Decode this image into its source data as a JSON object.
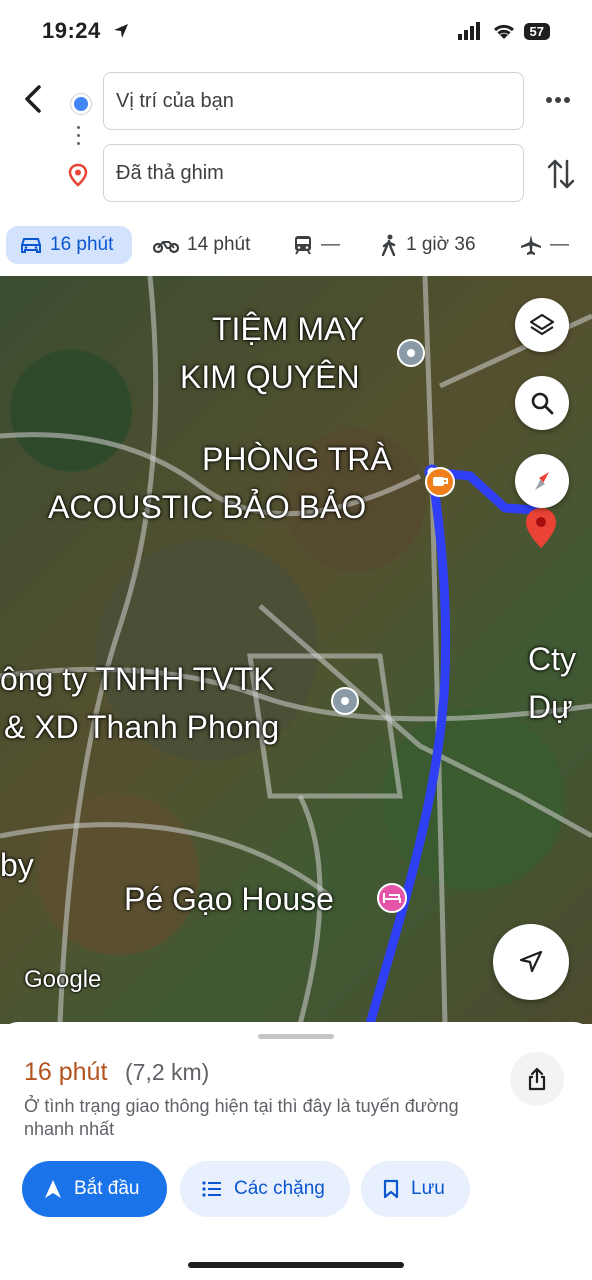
{
  "status_bar": {
    "time": "19:24",
    "battery": "57"
  },
  "directions": {
    "origin": "Vị trí của bạn",
    "destination": "Đã thả ghim"
  },
  "travel_modes": [
    {
      "mode": "car",
      "label": "16 phút",
      "selected": true
    },
    {
      "mode": "motorbike",
      "label": "14 phút"
    },
    {
      "mode": "transit",
      "label": "—"
    },
    {
      "mode": "walk",
      "label": "1 giờ 36"
    },
    {
      "mode": "flight",
      "label": "—"
    }
  ],
  "map": {
    "labels": {
      "tiem_may_1": "TIỆM MAY",
      "tiem_may_2": "KIM QUYÊN",
      "phong_tra_1": "PHÒNG TRÀ",
      "phong_tra_2": "ACOUSTIC BẢO BẢO",
      "cong_ty_1": "ông ty TNHH TVTK",
      "cong_ty_2": "& XD Thanh Phong",
      "cty_1": "Cty",
      "cty_2": "Dự",
      "by": "by",
      "pe_gao": "Pé Gạo House"
    },
    "attribution": "Google",
    "route_color": "#2f3ff5"
  },
  "route_summary": {
    "duration": "16 phút",
    "distance": "(7,2 km)",
    "description": "Ở tình trạng giao thông hiện tại thì đây là tuyến đường nhanh nhất"
  },
  "actions": {
    "start": "Bắt đầu",
    "stops": "Các chặng",
    "save": "Lưu"
  },
  "colors": {
    "accent": "#1a73e8",
    "duration_text": "#b3541e",
    "pin": "#ea4335"
  }
}
